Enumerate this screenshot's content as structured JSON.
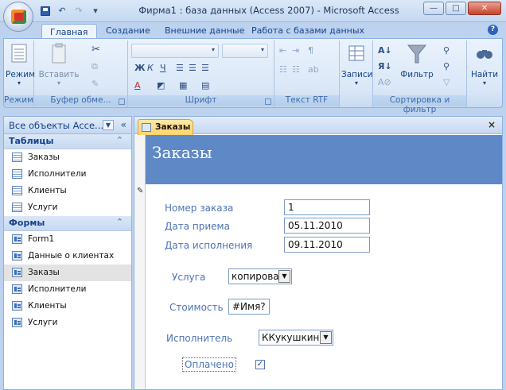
{
  "window": {
    "title": "Фирма1 : база данных (Access 2007) - Microsoft Access",
    "qat_undo": "↶",
    "qat_redo": "↷",
    "qat_more": "▾",
    "btn_min": "—",
    "btn_max": "□",
    "btn_close": "✕"
  },
  "ribbon": {
    "tabs": [
      "Главная",
      "Создание",
      "Внешние данные",
      "Работа с базами данных"
    ],
    "active_tab": "Главная",
    "help": "?",
    "groups": {
      "views": {
        "label": "Режимы",
        "button": "Режим"
      },
      "clipboard": {
        "label": "Буфер обме...",
        "paste": "Вставить"
      },
      "font": {
        "label": "Шрифт",
        "bold": "Ж",
        "italic": "К",
        "underline": "Ч"
      },
      "rich_text": {
        "label": "Текст RTF"
      },
      "records": {
        "label": "Записи",
        "button": "Записи"
      },
      "sort_filter": {
        "label": "Сортировка и фильтр",
        "filter": "Фильтр"
      },
      "find": {
        "button": "Найти"
      }
    }
  },
  "nav": {
    "title": "Все объекты Acce...",
    "collapse": "«",
    "groups": [
      {
        "title": "Таблицы",
        "items": [
          "Заказы",
          "Исполнители",
          "Клиенты",
          "Услуги"
        ]
      },
      {
        "title": "Формы",
        "items": [
          "Form1",
          "Данные о клиентах",
          "Заказы",
          "Исполнители",
          "Клиенты",
          "Услуги"
        ]
      }
    ],
    "selected_item": "Заказы"
  },
  "document": {
    "tab_label": "Заказы",
    "close": "×",
    "form_title": "Заказы",
    "fields": {
      "order_number": {
        "label": "Номер заказа",
        "value": "1"
      },
      "received_date": {
        "label": "Дата приема",
        "value": "05.11.2010"
      },
      "completion_date": {
        "label": "Дата исполнения",
        "value": "09.11.2010"
      },
      "service": {
        "label": "Услуга",
        "value": "копироваі"
      },
      "cost": {
        "label": "Стоимость",
        "value": "#Имя?"
      },
      "executor": {
        "label": "Исполнитель",
        "value": "ККукушкин"
      },
      "paid": {
        "label": "Оплачено",
        "checked": true
      }
    }
  },
  "colors": {
    "form_header": "#5f89c6",
    "label_blue": "#4d73b4",
    "tab_active": "#ffd46a"
  }
}
